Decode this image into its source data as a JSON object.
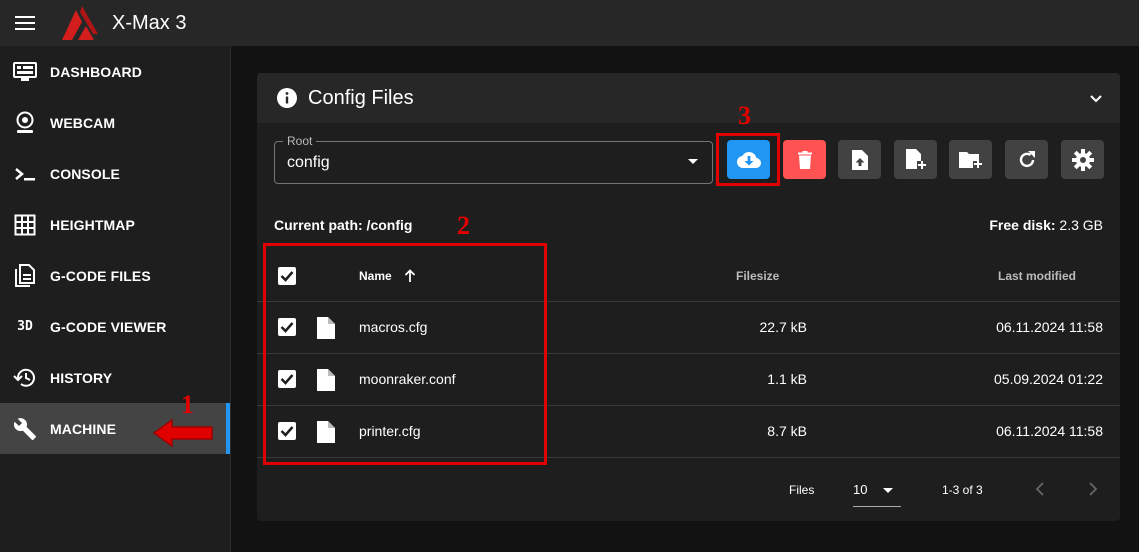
{
  "app": {
    "title": "X-Max 3"
  },
  "sidebar": {
    "items": [
      {
        "label": "DASHBOARD",
        "icon": "monitor-dashboard-icon"
      },
      {
        "label": "WEBCAM",
        "icon": "webcam-icon"
      },
      {
        "label": "CONSOLE",
        "icon": "console-icon"
      },
      {
        "label": "HEIGHTMAP",
        "icon": "grid-icon"
      },
      {
        "label": "G-CODE FILES",
        "icon": "file-document-multiple-icon"
      },
      {
        "label": "G-CODE VIEWER",
        "icon": "3d-icon",
        "icon_text": "3D"
      },
      {
        "label": "HISTORY",
        "icon": "history-icon"
      },
      {
        "label": "MACHINE",
        "icon": "wrench-icon",
        "active": true
      }
    ]
  },
  "card": {
    "title": "Config Files",
    "root_select": {
      "legend": "Root",
      "value": "config"
    },
    "toolbar": [
      {
        "name": "download-button",
        "icon": "cloud-download-icon"
      },
      {
        "name": "delete-button",
        "icon": "trash-icon"
      },
      {
        "name": "upload-file-button",
        "icon": "file-upload-icon"
      },
      {
        "name": "new-file-button",
        "icon": "file-plus-icon"
      },
      {
        "name": "new-folder-button",
        "icon": "folder-plus-icon"
      },
      {
        "name": "refresh-button",
        "icon": "refresh-icon"
      },
      {
        "name": "settings-button",
        "icon": "gear-icon"
      }
    ],
    "current_path_label": "Current path: /config",
    "free_disk_label": "Free disk:",
    "free_disk_value": "2.3 GB",
    "table": {
      "columns": {
        "name": "Name",
        "filesize": "Filesize",
        "modified": "Last modified"
      },
      "rows": [
        {
          "name": "macros.cfg",
          "size": "22.7 kB",
          "modified": "06.11.2024 11:58",
          "checked": true
        },
        {
          "name": "moonraker.conf",
          "size": "1.1 kB",
          "modified": "05.09.2024 01:22",
          "checked": true
        },
        {
          "name": "printer.cfg",
          "size": "8.7 kB",
          "modified": "06.11.2024 11:58",
          "checked": true
        }
      ]
    },
    "footer": {
      "files_label": "Files",
      "per_page": "10",
      "range": "1-3 of 3"
    }
  },
  "annotations": {
    "one": "1",
    "two": "2",
    "three": "3"
  },
  "colors": {
    "primary": "#2196f3",
    "danger": "#ff5252",
    "annotation": "#e00000",
    "logo": "#d41e1e"
  }
}
